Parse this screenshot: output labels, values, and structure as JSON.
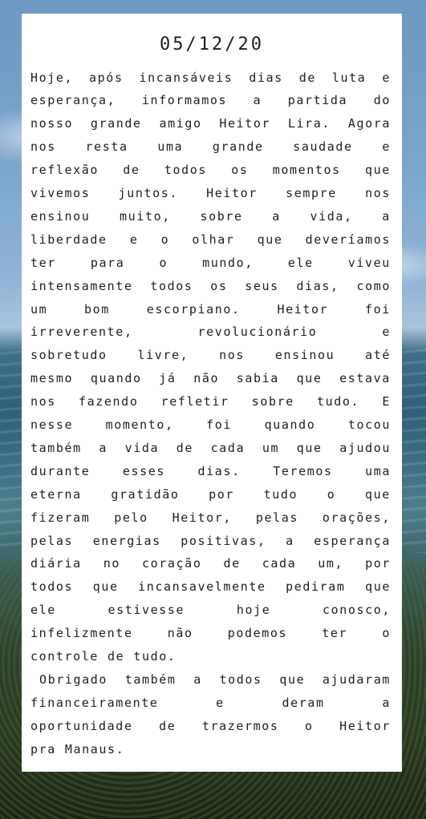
{
  "post": {
    "date": "05/12/20",
    "lines": [
      "Hoje, após incansáveis dias de luta e",
      "esperança, informamos a partida do",
      "nosso grande amigo Heitor Lira. Agora",
      "nos resta uma grande saudade e",
      "reflexão de todos os momentos que",
      "vivemos juntos. Heitor sempre nos",
      "ensinou muito, sobre a vida, a",
      "liberdade e o olhar que deveríamos",
      "ter para o mundo, ele viveu",
      "intensamente todos os seus dias, como",
      "um bom escorpiano. Heitor foi",
      "irreverente, revolucionário e",
      "sobretudo livre, nos ensinou até",
      "mesmo quando já não sabia que estava",
      "nos fazendo refletir sobre tudo. E",
      "nesse momento, foi quando tocou",
      "também a vida de cada um que ajudou",
      "durante esses dias. Teremos uma",
      "eterna gratidão por tudo o que",
      "fizeram pelo Heitor, pelas orações,",
      "pelas energias positivas, a esperança",
      "diária no coração de cada um, por",
      "todos que incansavelmente pediram que",
      "ele estivesse hoje conosco,",
      "infelizmente não podemos ter o",
      "controle de tudo.",
      "Obrigado também a todos que ajudaram",
      "financeiramente e deram a",
      "oportunidade de trazermos o Heitor",
      "pra Manaus."
    ]
  }
}
